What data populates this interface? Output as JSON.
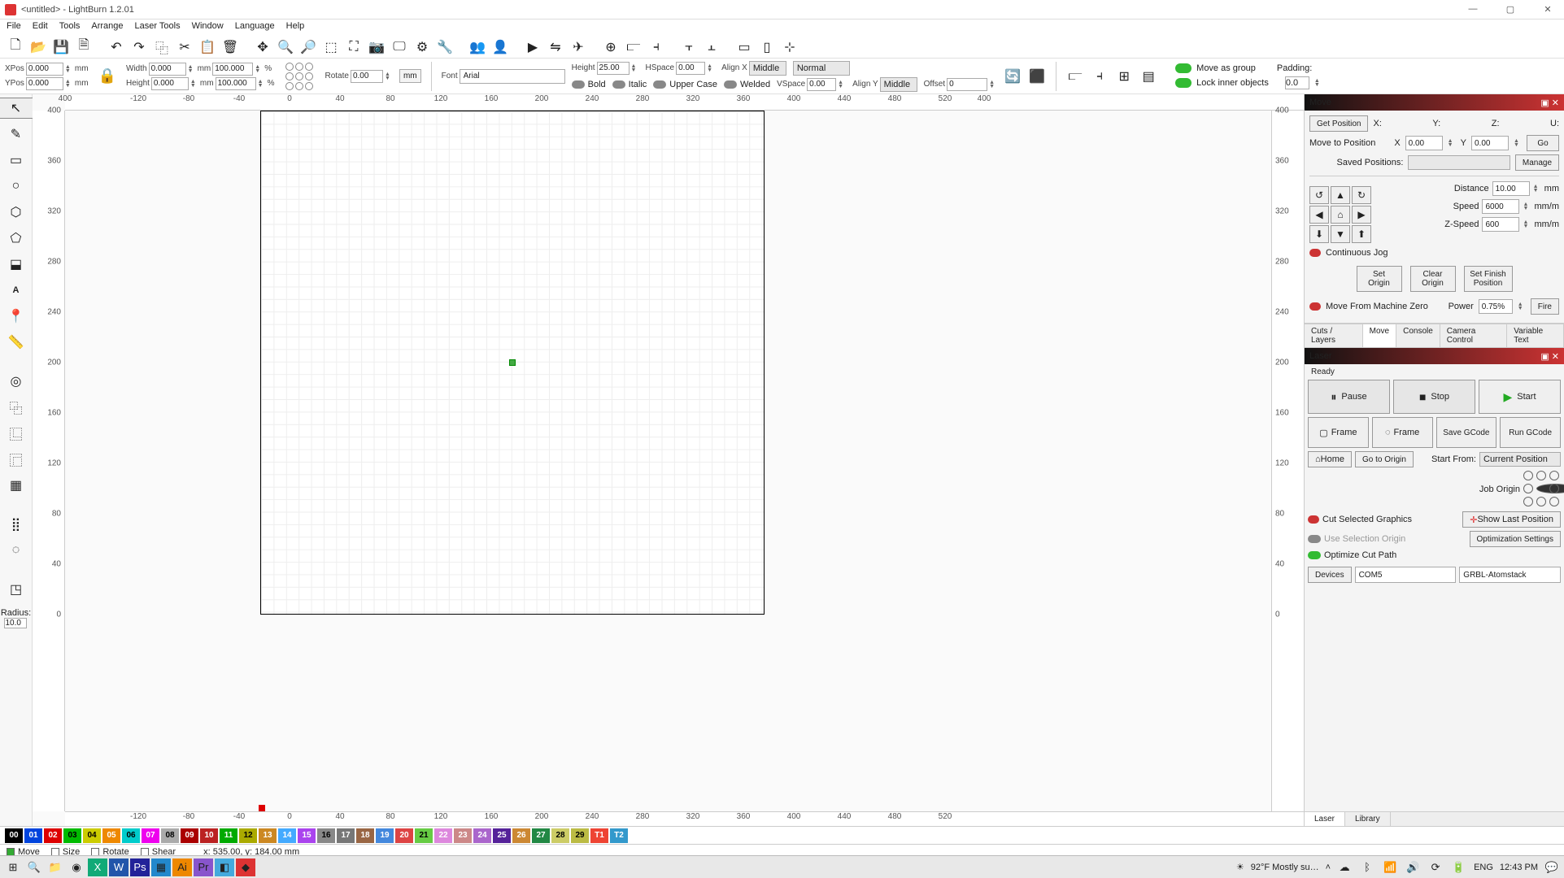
{
  "window": {
    "title": "<untitled> - LightBurn 1.2.01"
  },
  "menu": [
    "File",
    "Edit",
    "Tools",
    "Arrange",
    "Laser Tools",
    "Window",
    "Language",
    "Help"
  ],
  "pos": {
    "xpos_lbl": "XPos",
    "xpos": "0.000",
    "ypos_lbl": "YPos",
    "ypos": "0.000",
    "width_lbl": "Width",
    "width": "0.000",
    "height_lbl": "Height",
    "height": "0.000",
    "pct1": "100.000",
    "pct2": "100.000",
    "rotate_lbl": "Rotate",
    "rotate": "0.00",
    "mm": "mm",
    "pct": "%",
    "mmbtn": "mm"
  },
  "font": {
    "lbl": "Font",
    "value": "Arial",
    "height_lbl": "Height",
    "height": "25.00",
    "hspace_lbl": "HSpace",
    "hspace": "0.00",
    "vspace_lbl": "VSpace",
    "vspace": "0.00",
    "alignx_lbl": "Align X",
    "alignx": "Middle",
    "aligny_lbl": "Align Y",
    "aligny": "Middle",
    "normal": "Normal",
    "offset_lbl": "Offset",
    "offset": "0",
    "bold": "Bold",
    "italic": "Italic",
    "upper": "Upper Case",
    "welded": "Welded"
  },
  "group": {
    "moveasgroup": "Move as group",
    "lockinner": "Lock inner objects",
    "padding_lbl": "Padding:",
    "padding": "0.0"
  },
  "ruler_top": [
    "400",
    "-120",
    "-80",
    "-40",
    "0",
    "40",
    "80",
    "120",
    "160",
    "200",
    "240",
    "280",
    "320",
    "360",
    "400",
    "440",
    "480",
    "520",
    "400"
  ],
  "ruler_bottom": [
    "-120",
    "-80",
    "-40",
    "0",
    "40",
    "80",
    "120",
    "160",
    "200",
    "240",
    "280",
    "320",
    "360",
    "400",
    "440",
    "480",
    "520"
  ],
  "ruler_left": [
    "400",
    "360",
    "320",
    "280",
    "240",
    "200",
    "160",
    "120",
    "80",
    "40",
    "0"
  ],
  "ruler_right": [
    "400",
    "360",
    "320",
    "280",
    "240",
    "200",
    "160",
    "120",
    "80",
    "40",
    "0"
  ],
  "radius": {
    "lbl": "Radius:",
    "val": "10.0"
  },
  "move": {
    "title": "Move",
    "getpos": "Get Position",
    "x_lbl": "X:",
    "y_lbl": "Y:",
    "z_lbl": "Z:",
    "u_lbl": "U:",
    "movetopos": "Move to Position",
    "x": "0.00",
    "y": "0.00",
    "X": "X",
    "Y": "Y",
    "go": "Go",
    "savedpos": "Saved Positions:",
    "manage": "Manage",
    "dist_lbl": "Distance",
    "dist": "10.00",
    "mm": "mm",
    "speed_lbl": "Speed",
    "speed": "6000",
    "mmm": "mm/m",
    "zspeed_lbl": "Z-Speed",
    "zspeed": "600",
    "mmm2": "mm/m",
    "contjog": "Continuous Jog",
    "setorigin": "Set\nOrigin",
    "clearorigin": "Clear\nOrigin",
    "setfinish": "Set Finish\nPosition",
    "movefrom": "Move From Machine Zero",
    "power_lbl": "Power",
    "power": "0.75%",
    "fire": "Fire"
  },
  "tabs_mid": [
    "Cuts / Layers",
    "Move",
    "Console",
    "Camera Control",
    "Variable Text"
  ],
  "laser": {
    "title": "Laser",
    "ready": "Ready",
    "pause": "Pause",
    "stop": "Stop",
    "start": "Start",
    "frame1": "Frame",
    "frame2": "Frame",
    "savegcode": "Save GCode",
    "rungcode": "Run GCode",
    "home": "Home",
    "gotoorigin": "Go to Origin",
    "startfrom_lbl": "Start From:",
    "startfrom": "Current Position",
    "joborigin": "Job Origin",
    "cutselected": "Cut Selected Graphics",
    "useselection": "Use Selection Origin",
    "optimize": "Optimize Cut Path",
    "showlast": "Show Last Position",
    "optsettings": "Optimization Settings",
    "devices": "Devices",
    "port": "COM5",
    "device": "GRBL-Atomstack"
  },
  "tabs_bottom": [
    "Laser",
    "Library"
  ],
  "palette": [
    {
      "n": "00",
      "c": "#000"
    },
    {
      "n": "01",
      "c": "#04d"
    },
    {
      "n": "02",
      "c": "#d00"
    },
    {
      "n": "03",
      "c": "#0b0"
    },
    {
      "n": "04",
      "c": "#cc0"
    },
    {
      "n": "05",
      "c": "#e80"
    },
    {
      "n": "06",
      "c": "#0cc"
    },
    {
      "n": "07",
      "c": "#e0e"
    },
    {
      "n": "08",
      "c": "#aaa"
    },
    {
      "n": "09",
      "c": "#a00"
    },
    {
      "n": "10",
      "c": "#b22"
    },
    {
      "n": "11",
      "c": "#0a0"
    },
    {
      "n": "12",
      "c": "#aa0"
    },
    {
      "n": "13",
      "c": "#c82"
    },
    {
      "n": "14",
      "c": "#4af"
    },
    {
      "n": "15",
      "c": "#a4e"
    },
    {
      "n": "16",
      "c": "#888"
    },
    {
      "n": "17",
      "c": "#777"
    },
    {
      "n": "18",
      "c": "#964"
    },
    {
      "n": "19",
      "c": "#48d"
    },
    {
      "n": "20",
      "c": "#d44"
    },
    {
      "n": "21",
      "c": "#6c4"
    },
    {
      "n": "22",
      "c": "#d8d"
    },
    {
      "n": "23",
      "c": "#c88"
    },
    {
      "n": "24",
      "c": "#a6c"
    },
    {
      "n": "25",
      "c": "#529"
    },
    {
      "n": "26",
      "c": "#c83"
    },
    {
      "n": "27",
      "c": "#284"
    },
    {
      "n": "28",
      "c": "#cc6"
    },
    {
      "n": "29",
      "c": "#bb4"
    },
    {
      "n": "T1",
      "c": "#e43"
    },
    {
      "n": "T2",
      "c": "#39c"
    }
  ],
  "status": {
    "move": "Move",
    "size": "Size",
    "rotate": "Rotate",
    "shear": "Shear",
    "coords": "x: 535.00, y: 184.00 mm"
  },
  "tray": {
    "weather": "92°F  Mostly su…",
    "lang": "ENG",
    "time": "12:43 PM"
  }
}
